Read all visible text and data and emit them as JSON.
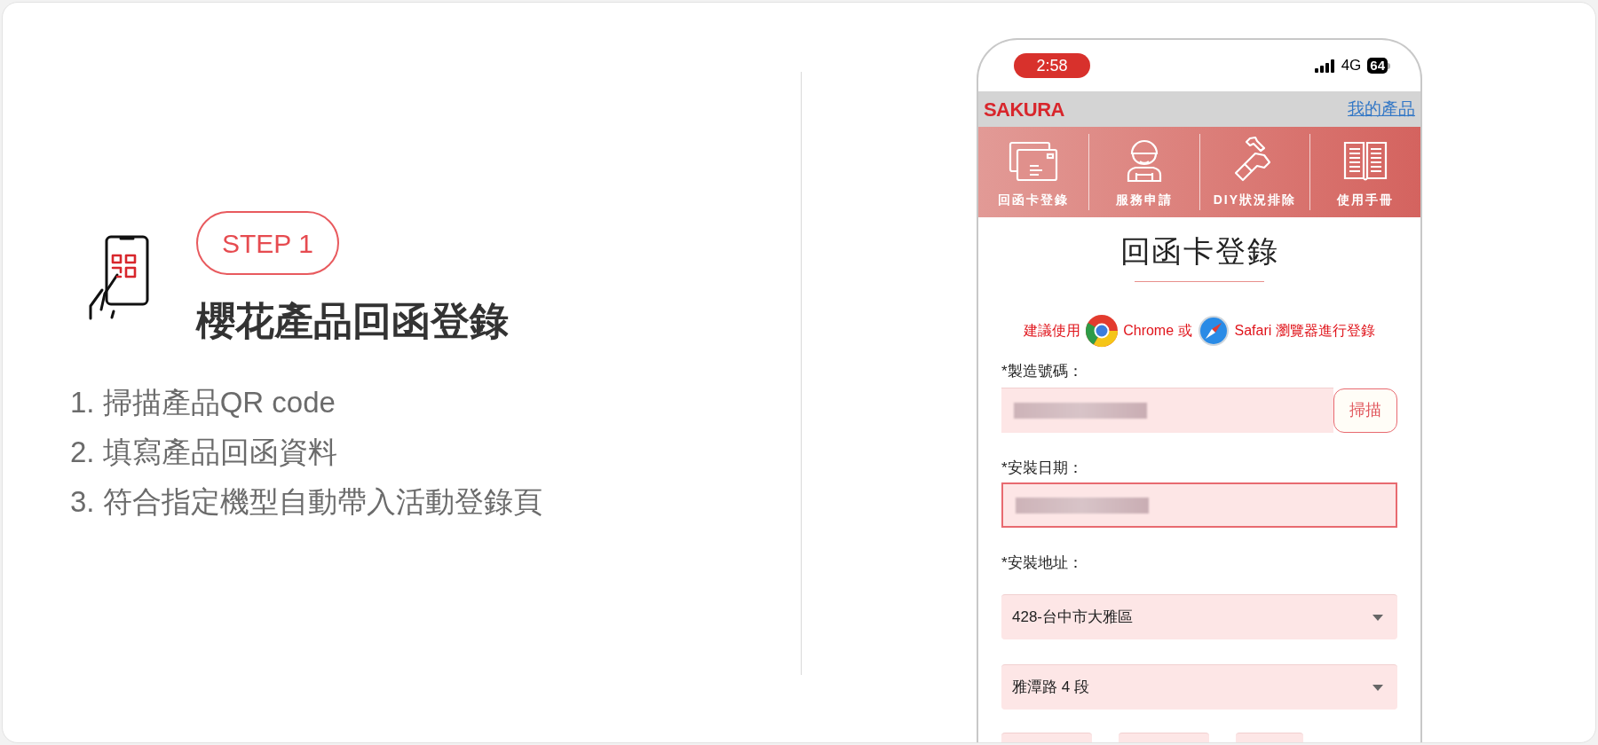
{
  "intro": {
    "badge": "STEP 1",
    "title": "櫻花產品回函登錄",
    "steps": [
      "1. 掃描產品QR code",
      "2. 填寫產品回函資料",
      "3. 符合指定機型自動帶入活動登錄頁"
    ]
  },
  "phone": {
    "status_bar": {
      "time": "2:58",
      "network": "4G",
      "battery": "64"
    },
    "header": {
      "logo": "SAKURA",
      "link": "我的產品"
    },
    "menu": [
      {
        "kind": "card",
        "label": "回函卡登錄"
      },
      {
        "kind": "worker",
        "label": "服務申請"
      },
      {
        "kind": "repair",
        "label": "DIY狀況排除"
      },
      {
        "kind": "manual",
        "label": "使用手冊"
      }
    ],
    "page_title": "回函卡登錄",
    "browser_notice": {
      "prefix": "建議使用",
      "chrome": "Chrome 或",
      "safari": "Safari 瀏覽器進行登錄"
    },
    "form": [
      {
        "kind": "label",
        "text": "*製造號碼："
      },
      {
        "kind": "input",
        "redacted": true,
        "highlighted": false,
        "button": "掃描"
      },
      {
        "kind": "label",
        "text": "*安裝日期："
      },
      {
        "kind": "input",
        "redacted": true,
        "highlighted": true
      },
      {
        "kind": "label",
        "text": "*安裝地址："
      },
      {
        "kind": "select",
        "value": "428-台中市大雅區"
      },
      {
        "kind": "select",
        "value": "雅潭路 4 段"
      }
    ]
  }
}
